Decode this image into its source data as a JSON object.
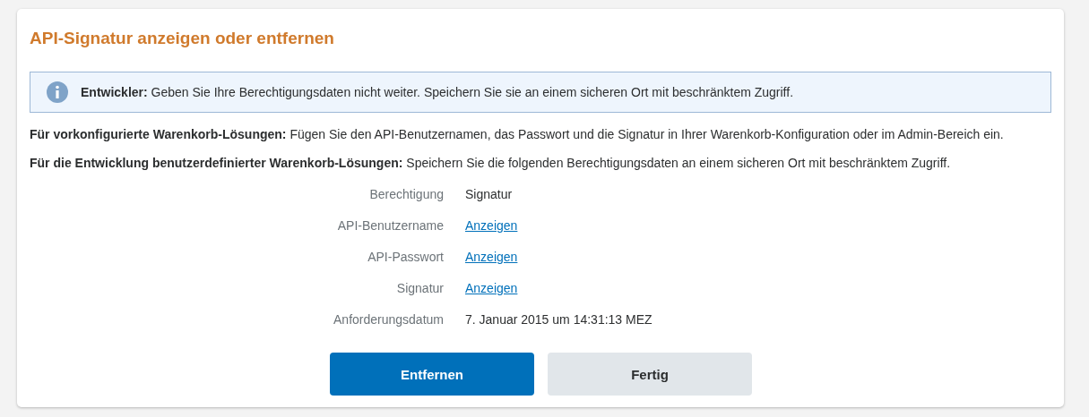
{
  "title": "API-Signatur anzeigen oder entfernen",
  "notice": {
    "text": "**Entwickler:** Geben Sie Ihre Berechtigungsdaten nicht weiter. Speichern Sie sie an einem sicheren Ort mit beschränktem Zugriff."
  },
  "paragraphs": [
    "**Für vorkonfigurierte Warenkorb-Lösungen:** Fügen Sie den API-Benutzernamen, das Passwort und die Signatur in Ihrer Warenkorb-Konfiguration oder im Admin-Bereich ein.",
    "**Für die Entwicklung benutzerdefinierter Warenkorb-Lösungen:** Speichern Sie die folgenden Berechtigungsdaten an einem sicheren Ort mit beschränktem Zugriff."
  ],
  "fields": [
    {
      "label": "Berechtigung",
      "kind": "text",
      "value": "Signatur"
    },
    {
      "label": "API-Benutzername",
      "kind": "link",
      "value": "Anzeigen"
    },
    {
      "label": "API-Passwort",
      "kind": "link",
      "value": "Anzeigen"
    },
    {
      "label": "Signatur",
      "kind": "link",
      "value": "Anzeigen"
    },
    {
      "label": "Anforderungsdatum",
      "kind": "text",
      "value": "7. Januar 2015 um 14:31:13 MEZ"
    }
  ],
  "buttons": [
    {
      "label": "Entfernen",
      "kind": "primary"
    },
    {
      "label": "Fertig",
      "kind": "secondary"
    }
  ]
}
